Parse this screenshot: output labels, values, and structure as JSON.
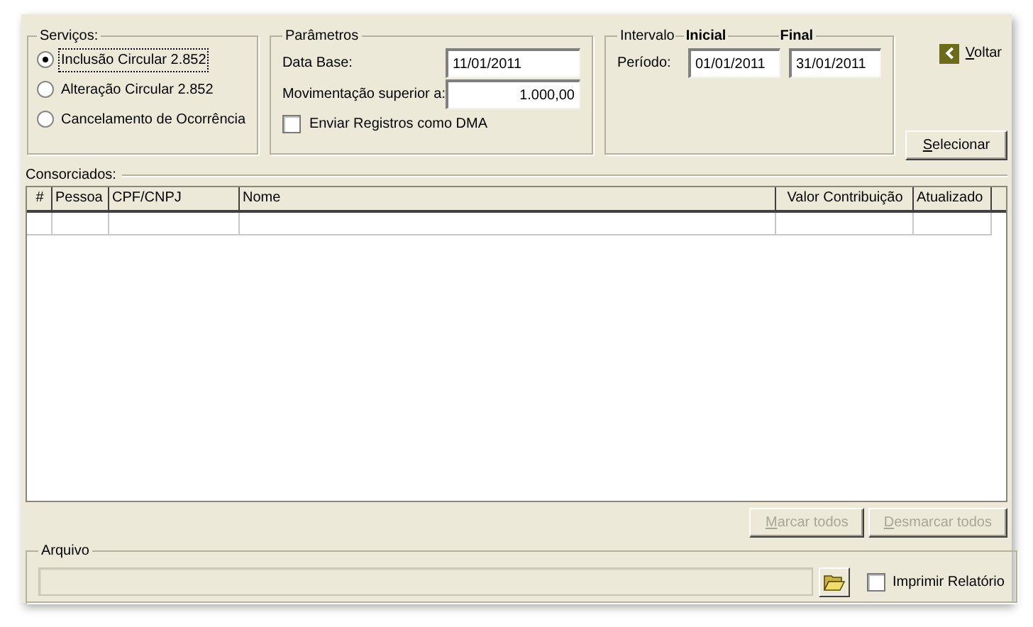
{
  "services": {
    "legend": "Serviços:",
    "options": [
      {
        "label": "Inclusão Circular 2.852",
        "selected": true
      },
      {
        "label": "Alteração Circular 2.852",
        "selected": false
      },
      {
        "label": "Cancelamento de Ocorrência",
        "selected": false
      }
    ]
  },
  "parameters": {
    "legend": "Parâmetros",
    "base_date_label": "Data Base:",
    "base_date": "11/01/2011",
    "movement_label": "Movimentação superior a:",
    "movement": "1.000,00",
    "dma": {
      "label": "Enviar Registros como DMA",
      "checked": false
    }
  },
  "interval": {
    "legend": "Intervalo",
    "start_label": "Inicial",
    "end_label": "Final",
    "period_label": "Período:",
    "start": "01/01/2011",
    "end": "31/01/2011"
  },
  "back_link": "Voltar",
  "select_button": "Selecionar",
  "table": {
    "title": "Consorciados:",
    "columns": [
      "#",
      "Pessoa",
      "CPF/CNPJ",
      "Nome",
      "Valor Contribuição",
      "Atualizado"
    ]
  },
  "actions": [
    {
      "label": "Marcar todos",
      "disabled": true
    },
    {
      "label": "Desmarcar todos",
      "disabled": true
    }
  ],
  "file": {
    "legend": "Arquivo",
    "print": {
      "label": "Imprimir Relatório",
      "checked": false
    }
  }
}
